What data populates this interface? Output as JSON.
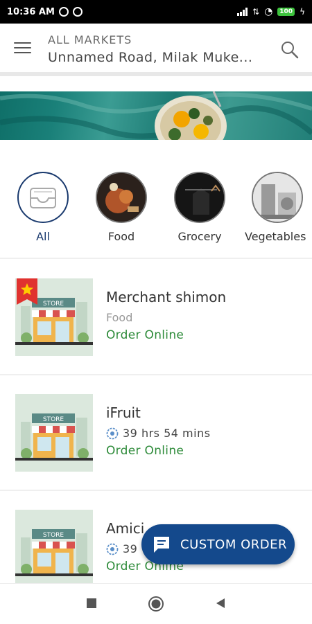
{
  "status_bar": {
    "time": "10:36 AM",
    "battery": "100"
  },
  "header": {
    "label": "ALL MARKETS",
    "address": "Unnamed Road, Milak Muke..."
  },
  "categories": [
    {
      "label": "All"
    },
    {
      "label": "Food"
    },
    {
      "label": "Grocery"
    },
    {
      "label": "Vegetables"
    }
  ],
  "stores": [
    {
      "name": "Merchant shimon",
      "subtitle": "Food",
      "link": "Order Online",
      "featured": true
    },
    {
      "name": "iFruit",
      "time": "39 hrs 54 mins",
      "link": "Order Online"
    },
    {
      "name": "Amici",
      "time": "39",
      "link": "Order Online"
    }
  ],
  "fab": {
    "label": "CUSTOM ORDER"
  },
  "store_thumb_label": "STORE",
  "colors": {
    "brand": "#14498c",
    "link": "#2e8b3a",
    "status_bar": "#000000",
    "banner": "#1a8079"
  }
}
